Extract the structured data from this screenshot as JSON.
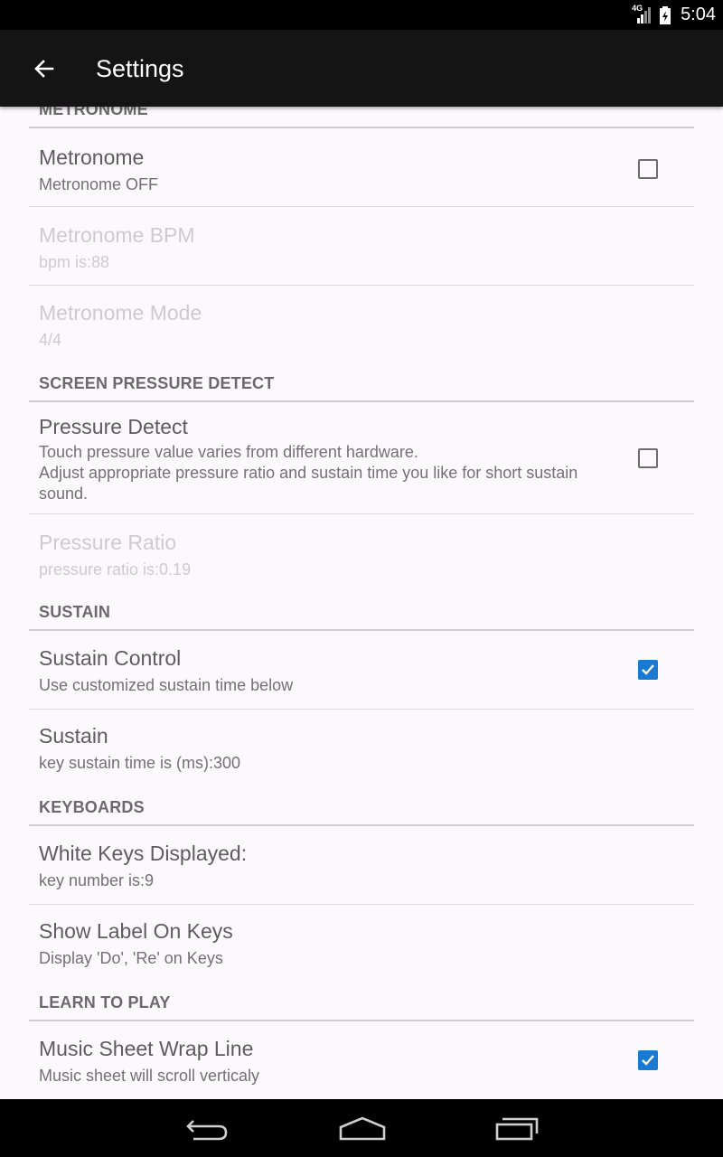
{
  "status_bar": {
    "network": "4G",
    "time": "5:04",
    "icons": [
      "signal-icon",
      "battery-charging-icon"
    ]
  },
  "toolbar": {
    "back_icon": "arrow-left-icon",
    "title": "Settings"
  },
  "sections": {
    "metronome": {
      "header": "METRONOME",
      "metronome": {
        "title": "Metronome",
        "summary": "Metronome OFF",
        "checked": false
      },
      "bpm": {
        "title": "Metronome BPM",
        "summary": "bpm is:88"
      },
      "mode": {
        "title": "Metronome Mode",
        "summary": "4/4"
      }
    },
    "pressure": {
      "header": "SCREEN PRESSURE DETECT",
      "detect": {
        "title": "Pressure Detect",
        "summary": "Touch pressure value varies from different hardware.\nAdjust appropriate pressure ratio and sustain time you like for short sustain sound.",
        "checked": false
      },
      "ratio": {
        "title": "Pressure Ratio",
        "summary": "pressure ratio is:0.19"
      }
    },
    "sustain": {
      "header": "SUSTAIN",
      "control": {
        "title": "Sustain Control",
        "summary": "Use customized sustain time below",
        "checked": true
      },
      "time": {
        "title": "Sustain",
        "summary": "key sustain time is (ms):300"
      }
    },
    "keyboards": {
      "header": "KEYBOARDS",
      "white_keys": {
        "title": "White Keys Displayed:",
        "summary": "key number is:9"
      },
      "labels": {
        "title": "Show Label On Keys",
        "summary": "Display 'Do', 'Re' on Keys"
      }
    },
    "learn": {
      "header": "LEARN TO PLAY",
      "wrap": {
        "title": "Music Sheet Wrap Line",
        "summary": "Music sheet will scroll verticaly",
        "checked": true
      }
    }
  },
  "nav_bar": {
    "icons": [
      "back-nav-icon",
      "home-nav-icon",
      "recents-nav-icon"
    ]
  },
  "colors": {
    "accent": "#1a79d0",
    "toolbar": "#141414",
    "background": "#fbf9fb"
  }
}
